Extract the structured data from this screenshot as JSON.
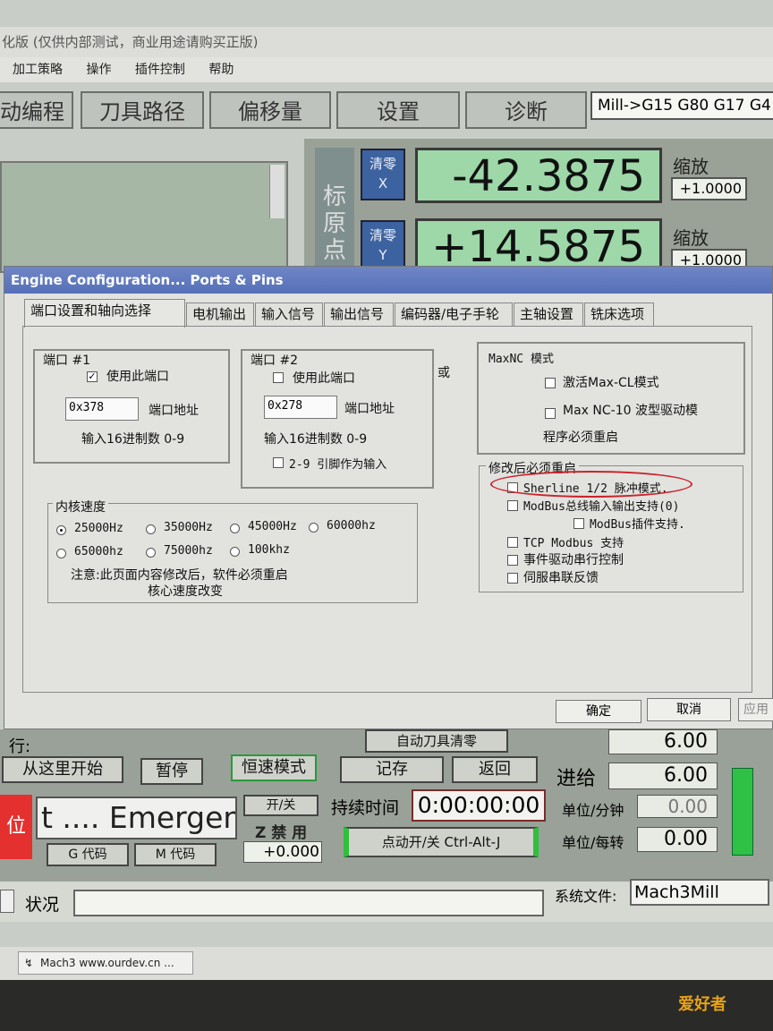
{
  "app": {
    "title": "化版 (仅供内部测试，商业用途请购买正版)",
    "menu": [
      "加工策略",
      "操作",
      "插件控制",
      "帮助"
    ],
    "main_tabs": [
      "动编程",
      "刀具路径",
      "偏移量",
      "设置",
      "诊断"
    ],
    "gcode_status": "Mill->G15  G80 G17 G4"
  },
  "dro": {
    "zero_label": "清零",
    "rows": [
      {
        "axis": "X",
        "value": "-42.3875",
        "scale_label": "缩放",
        "scale": "+1.0000"
      },
      {
        "axis": "Y",
        "value": "+14.5875",
        "scale_label": "缩放",
        "scale": "+1.0000"
      }
    ],
    "origin_label": "标原点"
  },
  "dialog": {
    "title": "Engine Configuration... Ports & Pins",
    "tabs": [
      "端口设置和轴向选择",
      "电机输出",
      "输入信号",
      "输出信号",
      "编码器/电子手轮",
      "主轴设置",
      "铣床选项"
    ],
    "port1": {
      "legend": "端口 #1",
      "enable_label": "使用此端口",
      "enable_checked": true,
      "address": "0x378",
      "address_label": "端口地址",
      "hint": "输入16进制数 0-9"
    },
    "port2": {
      "legend": "端口 #2",
      "enable_label": "使用此端口",
      "enable_checked": false,
      "address": "0x278",
      "address_label": "端口地址",
      "hint": "输入16进制数 0-9",
      "pins_label": "2-9 引脚作为输入"
    },
    "or_label": "或",
    "maxnc": {
      "legend": "MaxNC 模式",
      "opt1": "激活Max-CL模式",
      "opt2": "Max NC-10 波型驱动模",
      "note": "程序必须重启"
    },
    "restart": {
      "legend": "修改后必须重启",
      "options": [
        "Sherline 1/2 脉冲模式.",
        "ModBus总线输入输出支持(0)",
        "ModBus插件支持.",
        "TCP Modbus 支持",
        "事件驱动串行控制",
        "伺服串联反馈"
      ]
    },
    "kernel": {
      "legend": "内核速度",
      "speeds": [
        "25000Hz",
        "35000Hz",
        "45000Hz",
        "60000hz",
        "65000hz",
        "75000hz",
        "100khz"
      ],
      "selected": "25000Hz",
      "note1": "注意:此页面内容修改后，软件必须重启",
      "note2": "核心速度改变"
    },
    "ok_label": "确定",
    "cancel_label": "取消",
    "apply_label": "应用"
  },
  "lower": {
    "auto_tool_zero": "自动刀具清零",
    "tool_label": "行:",
    "run_from_here": "从这里开始",
    "pause": "暂停",
    "const_speed": "恒速模式",
    "record": "记存",
    "return": "返回",
    "duration_label": "持续时间",
    "duration": "0:00:00:00",
    "jog_toggle": "点动开/关 Ctrl-Alt-J",
    "emergency": "t .... Emergen",
    "on_off": "开/关",
    "z_inhibit": "Z 禁 用",
    "z_value": "+0.000",
    "gcode_btn": "G 代码",
    "mcode_btn": "M 代码",
    "feed_top": "6.00",
    "feed_label": "进给",
    "feed_value": "6.00",
    "units_per_min_label": "单位/分钟",
    "units_per_min": "0.00",
    "units_per_rev_label": "单位/每转",
    "units_per_rev": "0.00"
  },
  "status": {
    "status_label": "状况",
    "profile_label": "系统文件:",
    "profile": "Mach3Mill"
  },
  "taskbar": {
    "item": "Mach3 www.ourdev.cn ..."
  },
  "watermark": "爱好者"
}
